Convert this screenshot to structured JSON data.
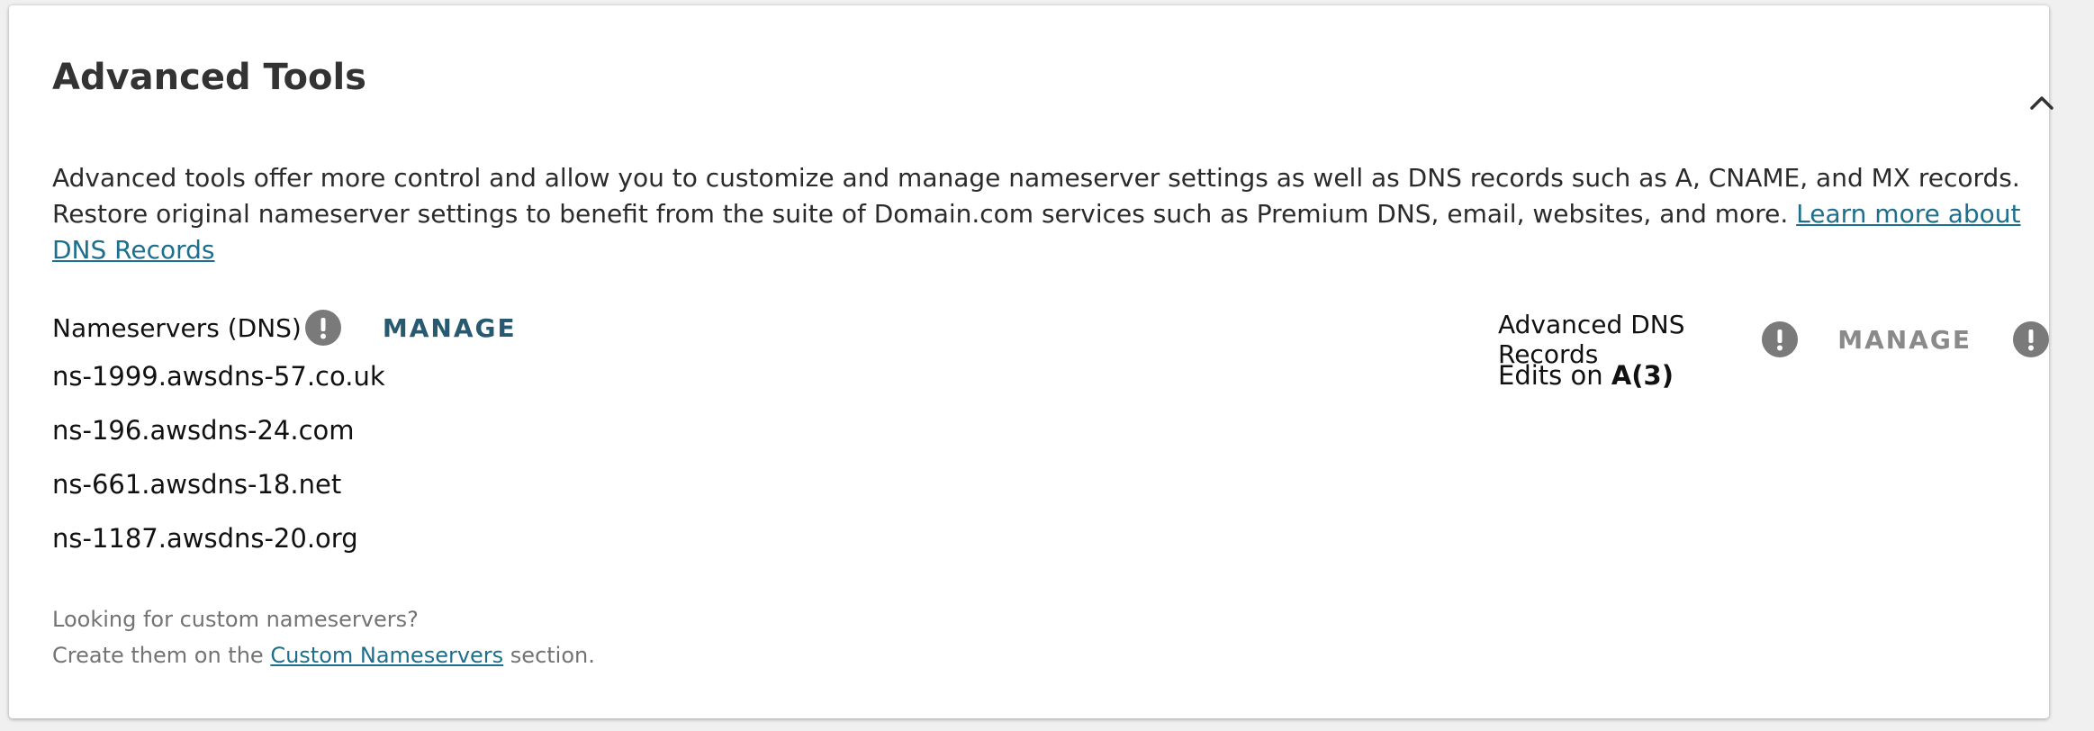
{
  "panel": {
    "title": "Advanced Tools",
    "collapse_icon": "chevron-up-icon",
    "description": "Advanced tools offer more control and allow you to customize and manage nameserver settings as well as DNS records such as A, CNAME, and MX records. Restore original nameserver settings to benefit from the suite of Domain.com services such as Premium DNS, email, websites, and more. ",
    "description_link": "Learn more about DNS Records"
  },
  "nameservers": {
    "label": "Nameservers (DNS)",
    "info_icon": "exclamation-icon",
    "manage_label": "MANAGE",
    "items": [
      "ns-1999.awsdns-57.co.uk",
      "ns-196.awsdns-24.com",
      "ns-661.awsdns-18.net",
      "ns-1187.awsdns-20.org"
    ]
  },
  "advanced_dns": {
    "label": "Advanced DNS Records",
    "info_icon": "exclamation-icon",
    "manage_label": "MANAGE",
    "edits_prefix": "Edits on ",
    "edits_value": "A(3)"
  },
  "footer": {
    "line1": "Looking for custom nameservers?",
    "line2_prefix": "Create them on the ",
    "line2_link": "Custom Nameservers",
    "line2_suffix": " section."
  },
  "colors": {
    "link": "#1e6f8e",
    "manage_active": "#275a70",
    "manage_disabled": "#8a8a8a",
    "icon_gray": "#7a7a7a"
  }
}
